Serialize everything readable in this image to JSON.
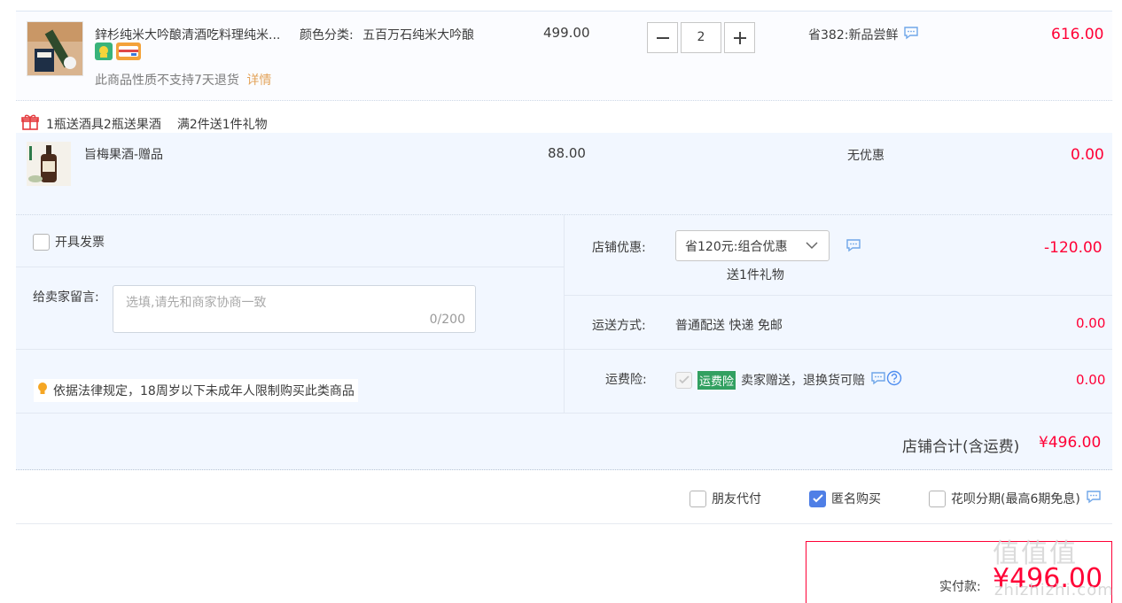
{
  "product": {
    "title": "鋅杉纯米大吟酿清酒吃料理纯米...",
    "sku_label": "颜色分类:",
    "sku_value": "五百万石纯米大吟酿",
    "price": "499.00",
    "quantity": "2",
    "promo": "省382:新品尝鲜",
    "total": "616.00",
    "note": "此商品性质不支持7天退货",
    "note_link": "详情"
  },
  "gift": {
    "rule1": "1瓶送酒具2瓶送果酒",
    "rule2": "满2件送1件礼物",
    "item_title": "旨梅果酒-赠品",
    "price": "88.00",
    "promo": "无优惠",
    "total": "0.00"
  },
  "options": {
    "invoice_label": "开具发票",
    "message_label": "给卖家留言:",
    "message_placeholder": "选填,请先和商家协商一致",
    "message_counter": "0/200",
    "legal_note": "依据法律规定，18周岁以下未成年人限制购买此类商品",
    "shop_discount_label": "店铺优惠:",
    "shop_discount_value": "省120元:组合优惠",
    "shop_discount_sub": "送1件礼物",
    "shop_discount_amount": "-120.00",
    "shipping_label": "运送方式:",
    "shipping_value": "普通配送 快递 免邮",
    "shipping_amount": "0.00",
    "insurance_label": "运费险:",
    "insurance_tag": "运费险",
    "insurance_value": "卖家赠送，退换货可赔",
    "insurance_amount": "0.00",
    "shop_total_label": "店铺合计(含运费)",
    "shop_total_value": "¥496.00"
  },
  "payment_options": {
    "friend_pay": "朋友代付",
    "anonymous": "匿名购买",
    "installment": "花呗分期(最高6期免息)"
  },
  "pay": {
    "label": "实付款:",
    "amount": "¥496.00"
  },
  "watermark": {
    "main": "值值值",
    "sub": "zhizhizhi.com"
  }
}
